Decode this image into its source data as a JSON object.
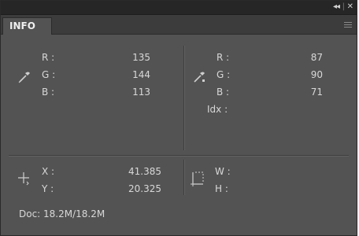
{
  "panel": {
    "tab_label": "INFO",
    "controls": {
      "collapse": "◂◂",
      "separator": "|",
      "close": "✕"
    }
  },
  "left_color": {
    "icon": "eyedropper-icon",
    "r_label": "R :",
    "g_label": "G :",
    "b_label": "B :",
    "r_value": "135",
    "g_value": "144",
    "b_value": "113"
  },
  "right_color": {
    "icon": "eyedropper-sample-icon",
    "r_label": "R :",
    "g_label": "G :",
    "b_label": "B :",
    "idx_label": "Idx :",
    "r_value": "87",
    "g_value": "90",
    "b_value": "71"
  },
  "position": {
    "icon": "crosshair-icon",
    "x_label": "X :",
    "y_label": "Y :",
    "x_value": "41.385",
    "y_value": "20.325"
  },
  "size": {
    "icon": "selection-size-icon",
    "w_label": "W :",
    "h_label": "H :"
  },
  "status": {
    "doc": "Doc: 18.2M/18.2M"
  },
  "colors": {
    "panel_bg": "#535353",
    "titlebar_bg": "#262626",
    "tabbar_bg": "#3c3c3c",
    "text": "#d8d8d8"
  }
}
